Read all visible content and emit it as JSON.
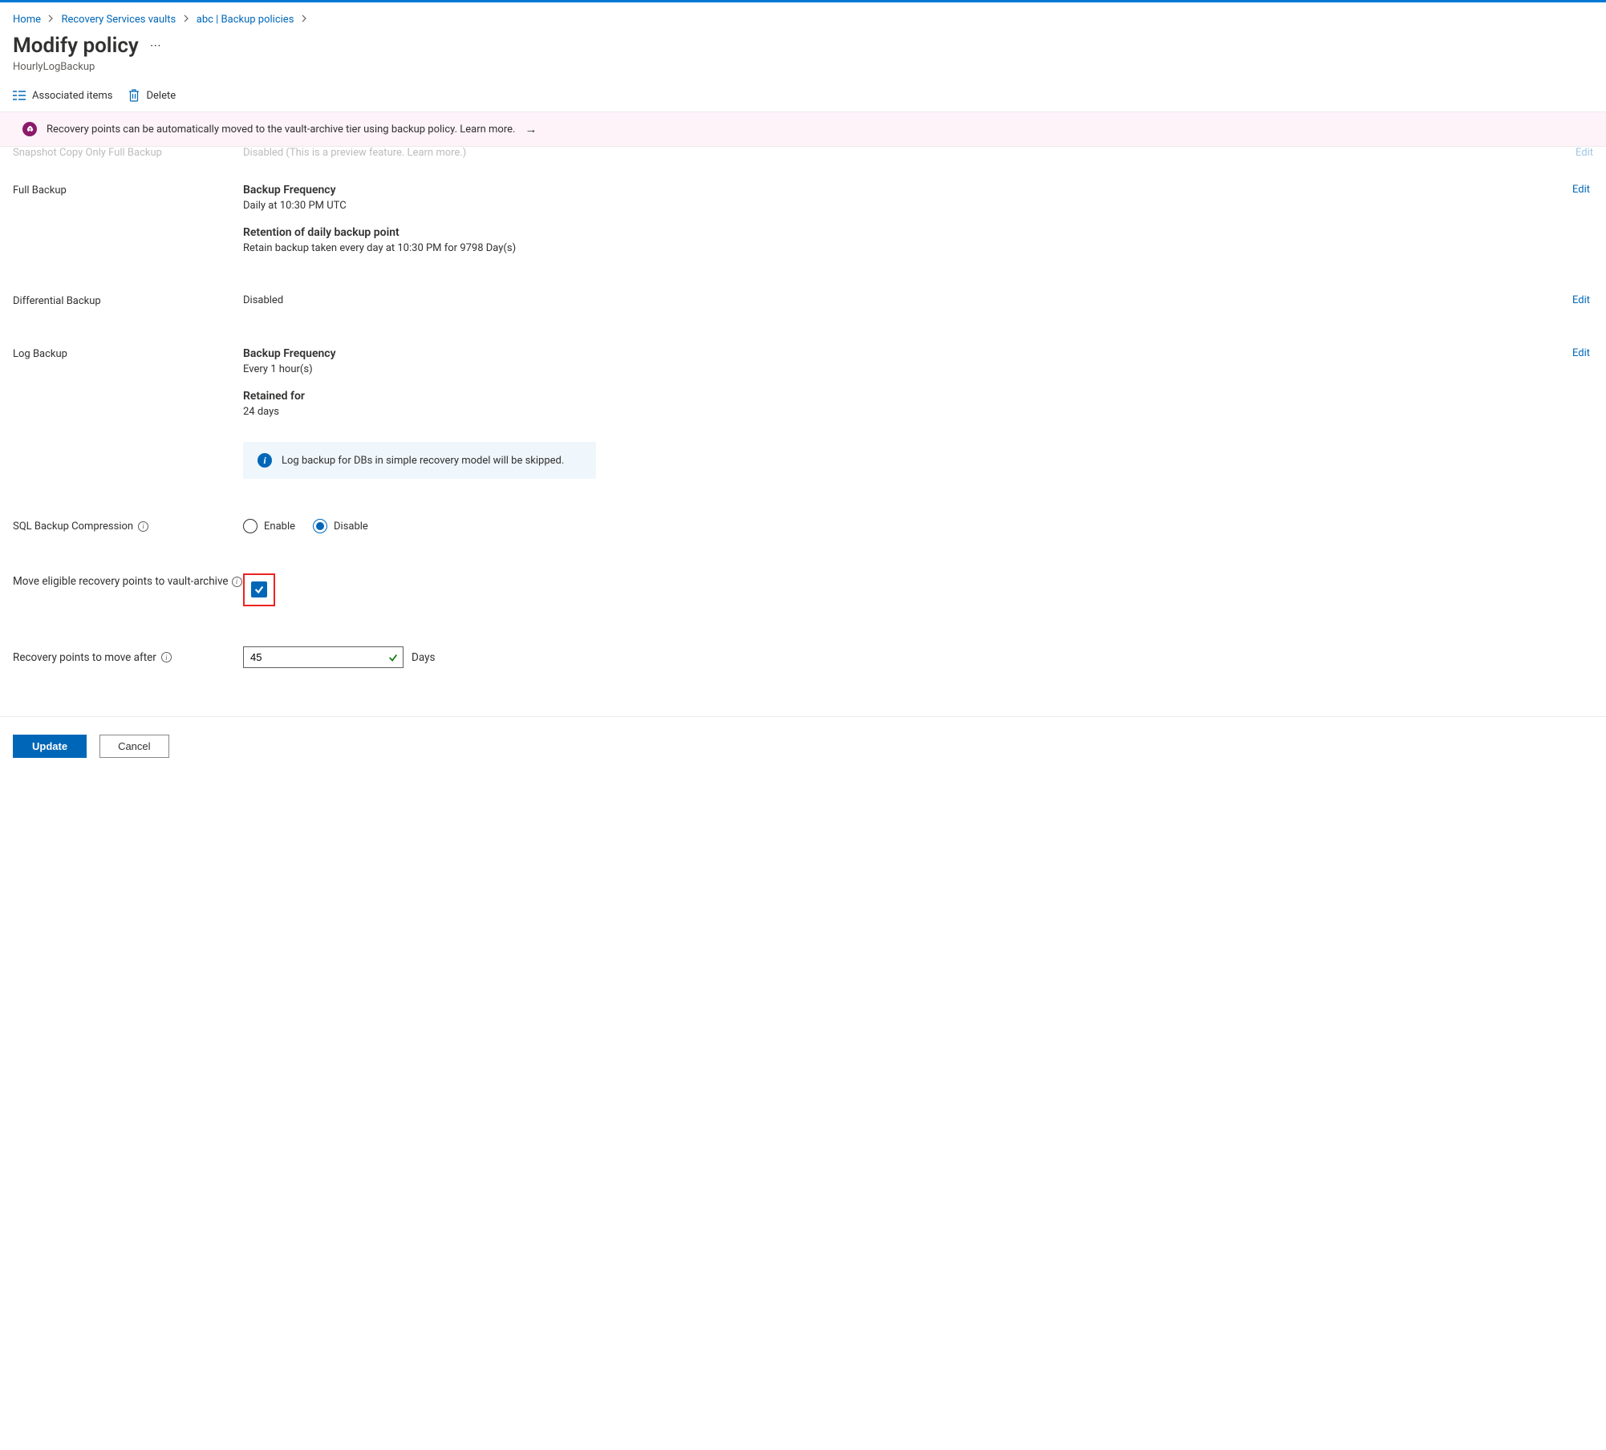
{
  "breadcrumbs": [
    "Home",
    "Recovery Services vaults",
    "abc | Backup policies"
  ],
  "title": "Modify policy",
  "subtitle": "HourlyLogBackup",
  "toolbar": {
    "associated": "Associated items",
    "delete": "Delete"
  },
  "banner": "Recovery points can be automatically moved to the vault-archive tier using backup policy. Learn more.",
  "partial": {
    "label": "Snapshot Copy Only Full Backup",
    "value": "Disabled (This is a preview feature. Learn more.)",
    "edit": "Edit"
  },
  "edit_label": "Edit",
  "full_backup": {
    "title": "Full Backup",
    "freq_label": "Backup Frequency",
    "freq_value": "Daily at 10:30 PM UTC",
    "ret_label": "Retention of daily backup point",
    "ret_value": "Retain backup taken every day at 10:30 PM for 9798 Day(s)"
  },
  "diff_backup": {
    "title": "Differential Backup",
    "value": "Disabled"
  },
  "log_backup": {
    "title": "Log Backup",
    "freq_label": "Backup Frequency",
    "freq_value": "Every 1 hour(s)",
    "ret_label": "Retained for",
    "ret_value": "24 days",
    "info": "Log backup for DBs in simple recovery model will be skipped."
  },
  "compression": {
    "label": "SQL Backup Compression",
    "enable": "Enable",
    "disable": "Disable",
    "selected": "disable"
  },
  "move_archive": {
    "label": "Move eligible recovery points to vault-archive",
    "checked": true
  },
  "move_after": {
    "label": "Recovery points to move after",
    "value": "45",
    "unit": "Days"
  },
  "footer": {
    "update": "Update",
    "cancel": "Cancel"
  }
}
